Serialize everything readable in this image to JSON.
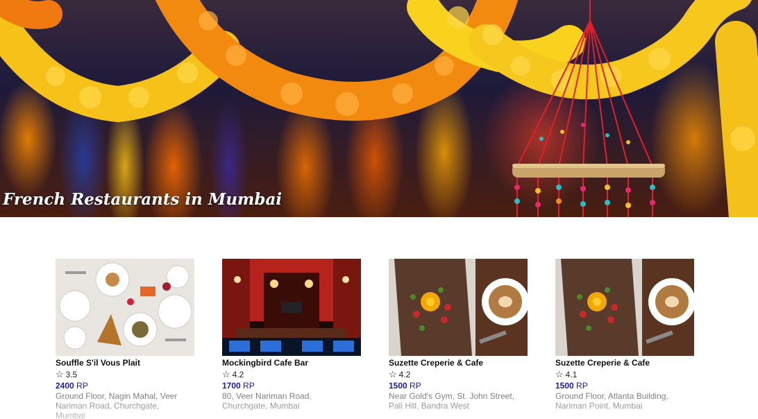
{
  "hero": {
    "title": "French Restaurants in Mumbai"
  },
  "restaurants": [
    {
      "name": "Souffle S'il Vous Plait",
      "rating": "3.5",
      "price": "2400",
      "currency": "RP",
      "address": "Ground Floor, Nagin Mahal, Veer Nariman Road, Churchgate, Mumbai",
      "image": "plated-dishes-photo"
    },
    {
      "name": "Mockingbird Cafe Bar",
      "rating": "4.2",
      "price": "1700",
      "currency": "RP",
      "address": "80, Veer Nariman Road, Churchgate, Mumbai",
      "image": "bar-interior-photo"
    },
    {
      "name": "Suzette Creperie & Cafe",
      "rating": "4.2",
      "price": "1500",
      "currency": "RP",
      "address": "Near Gold's Gym, St. John Street, Pali Hill, Bandra West",
      "image": "crepe-and-coffee-photo"
    },
    {
      "name": "Suzette Creperie & Cafe",
      "rating": "4.1",
      "price": "1500",
      "currency": "RP",
      "address": "Ground Floor, Atlanta Building, Nariman Point, Mumbai",
      "image": "crepe-and-coffee-photo"
    }
  ],
  "icons": {
    "rating": "star-outline-icon"
  },
  "colors": {
    "price": "#1a1aa6",
    "address": "#777777",
    "title": "#ffffff"
  }
}
